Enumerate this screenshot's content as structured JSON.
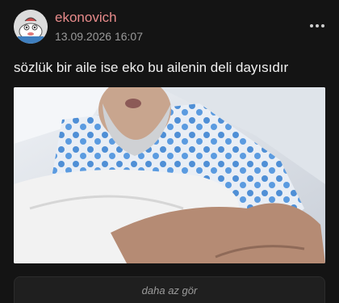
{
  "post": {
    "author": "ekonovich",
    "timestamp": "13.09.2026 16:07",
    "text": "sözlük bir aile ise eko bu ailenin deli dayısıdır",
    "image_icon": "photo-image",
    "more_icon": "more-dots-icon"
  },
  "actions": {
    "toggle_label": "daha az gör"
  },
  "colors": {
    "background": "#141414",
    "author": "#e88b8b",
    "meta": "#9a9a9a",
    "text": "#f0f0f0",
    "toggle_bg": "#1f1f1f"
  }
}
